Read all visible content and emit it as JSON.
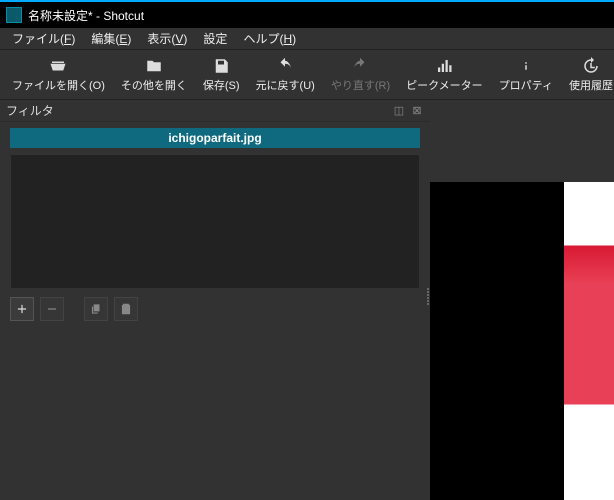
{
  "titlebar": {
    "text": "名称未設定* - Shotcut"
  },
  "menu": {
    "file": {
      "label": "ファイル",
      "mnemonic": "F"
    },
    "edit": {
      "label": "編集",
      "mnemonic": "E"
    },
    "view": {
      "label": "表示",
      "mnemonic": "V"
    },
    "settings": {
      "label": "設定"
    },
    "help": {
      "label": "ヘルプ",
      "mnemonic": "H"
    }
  },
  "toolbar": {
    "open_file": "ファイルを開く(O)",
    "open_other": "その他を開く",
    "save": "保存(S)",
    "undo": "元に戻す(U)",
    "redo": "やり直す(R)",
    "peak_meter": "ピークメーター",
    "properties": "プロパティ",
    "history": "使用履歴"
  },
  "filters": {
    "title": "フィルタ",
    "source_name": "ichigoparfait.jpg"
  }
}
